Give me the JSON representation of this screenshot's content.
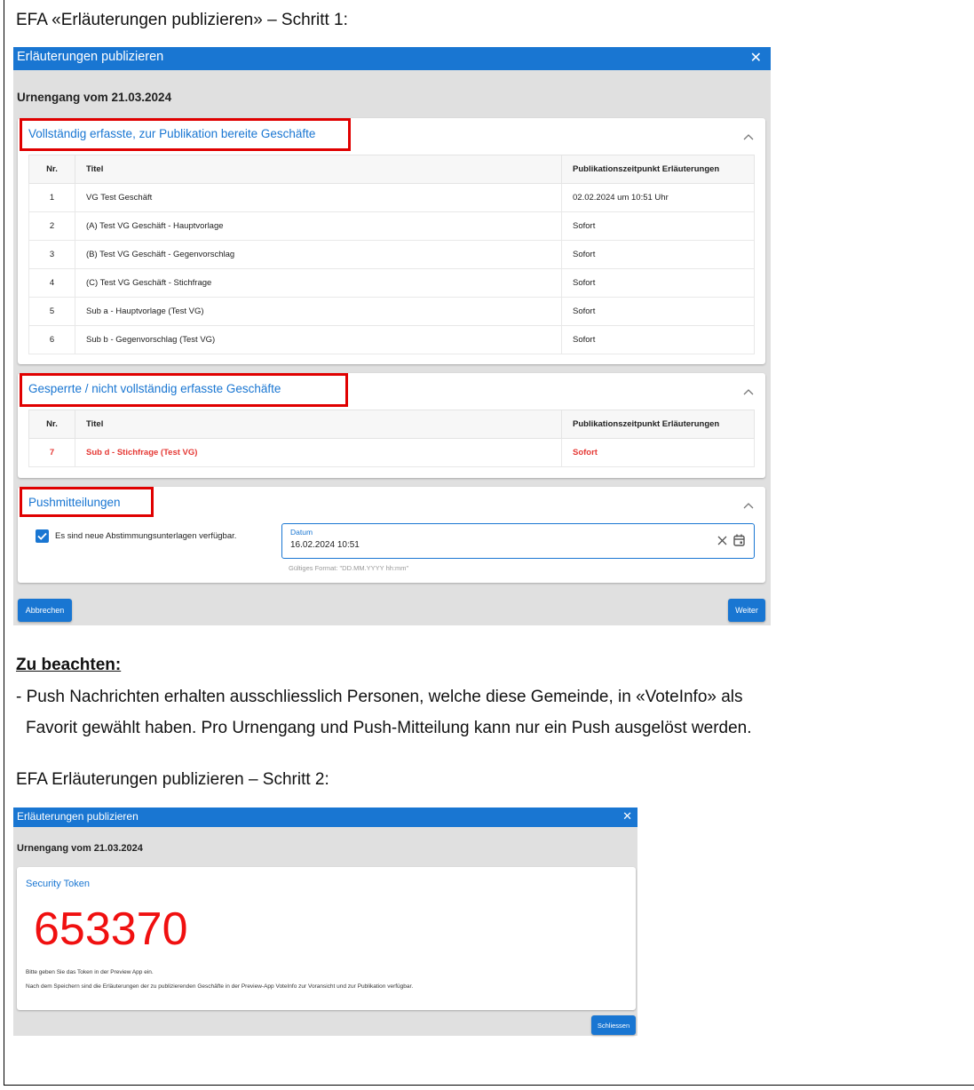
{
  "heading_step1": "EFA «Erläuterungen publizieren» – Schritt 1:",
  "dialog1": {
    "title": "Erläuterungen publizieren",
    "close": "✕",
    "subtitle": "Urnengang vom 21.03.2024",
    "ready_section": {
      "title": "Vollständig erfasste, zur Publikation bereite Geschäfte",
      "columns": [
        "Nr.",
        "Titel",
        "Publikationszeitpunkt Erläuterungen"
      ],
      "rows": [
        [
          "1",
          "VG Test Geschäft",
          "02.02.2024 um 10:51 Uhr"
        ],
        [
          "2",
          "(A) Test VG Geschäft - Hauptvorlage",
          "Sofort"
        ],
        [
          "3",
          "(B) Test VG Geschäft - Gegenvorschlag",
          "Sofort"
        ],
        [
          "4",
          "(C) Test VG Geschäft - Stichfrage",
          "Sofort"
        ],
        [
          "5",
          "Sub a - Hauptvorlage (Test VG)",
          "Sofort"
        ],
        [
          "6",
          "Sub b - Gegenvorschlag (Test VG)",
          "Sofort"
        ]
      ]
    },
    "locked_section": {
      "title": "Gesperrte / nicht vollständig erfasste Geschäfte",
      "columns": [
        "Nr.",
        "Titel",
        "Publikationszeitpunkt Erläuterungen"
      ],
      "rows": [
        [
          "7",
          "Sub d - Stichfrage (Test VG)",
          "Sofort"
        ]
      ]
    },
    "push_section": {
      "title": "Pushmitteilungen",
      "checkbox_label": "Es sind neue Abstimmungsunterlagen verfügbar.",
      "checkbox_checked": true,
      "date_label": "Datum",
      "date_value": "16.02.2024 10:51",
      "date_hint": "Gültiges Format: \"DD.MM.YYYY hh:mm\""
    },
    "cancel_button": "Abbrechen",
    "next_button": "Weiter"
  },
  "notes": {
    "heading": "Zu beachten:",
    "line1": "- Push Nachrichten erhalten ausschliesslich Personen, welche diese Gemeinde, in «VoteInfo» als",
    "line2": "Favorit gewählt haben. Pro Urnengang und Push-Mitteilung kann nur ein Push ausgelöst werden."
  },
  "heading_step2": "EFA Erläuterungen publizieren – Schritt 2:",
  "dialog2": {
    "title": "Erläuterungen publizieren",
    "close": "✕",
    "subtitle": "Urnengang vom 21.03.2024",
    "token_label": "Security Token",
    "token_value": "653370",
    "info1": "Bitte geben Sie das Token in der Preview App ein.",
    "info2": "Nach dem Speichern sind die Erläuterungen der zu publizierenden Geschäfte in der Preview-App VoteInfo zur Voransicht und zur Publikation verfügbar.",
    "close_button": "Schliessen"
  },
  "colors": {
    "primary": "#1976d2",
    "highlight_red": "#e00000",
    "token_red": "#f01010",
    "dialog_bg": "#e0e0e0"
  }
}
